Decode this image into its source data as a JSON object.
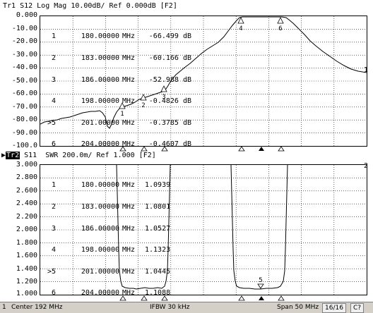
{
  "trace1": {
    "header": "Tr1 S12 Log Mag 10.00dB/ Ref 0.000dB [F2]",
    "y_labels": [
      "0.000",
      "-10.00",
      "-20.00",
      "-30.00",
      "-40.00",
      "-50.00",
      "-60.00",
      "-70.00",
      "-80.00",
      "-90.00",
      "-100.0"
    ],
    "right_tag": "1",
    "markers": [
      {
        "id": "1",
        "freq": "180.00000",
        "unit": "MHz",
        "value": "-66.499 dB"
      },
      {
        "id": "2",
        "freq": "183.00000",
        "unit": "MHz",
        "value": "-60.166 dB"
      },
      {
        "id": "3",
        "freq": "186.00000",
        "unit": "MHz",
        "value": "-52.988 dB"
      },
      {
        "id": "4",
        "freq": "198.00000",
        "unit": "MHz",
        "value": "-0.4826 dB"
      },
      {
        "id": ">5",
        "freq": "201.00000",
        "unit": "MHz",
        "value": "-0.3785 dB"
      },
      {
        "id": "6",
        "freq": "204.00000",
        "unit": "MHz",
        "value": "-0.4607 dB"
      }
    ],
    "marker_tags": [
      "1",
      "2",
      "3",
      "4",
      "5",
      "6"
    ]
  },
  "trace2": {
    "tag": "Tr2",
    "header_rest": " S11  SWR 200.0m/ Ref 1.000 [F2]",
    "y_labels": [
      "3.000",
      "2.800",
      "2.600",
      "2.400",
      "2.200",
      "2.000",
      "1.800",
      "1.600",
      "1.400",
      "1.200",
      "1.000"
    ],
    "right_tag": "2",
    "markers": [
      {
        "id": "1",
        "freq": "180.00000",
        "unit": "MHz",
        "value": "1.0939"
      },
      {
        "id": "2",
        "freq": "183.00000",
        "unit": "MHz",
        "value": "1.0801"
      },
      {
        "id": "3",
        "freq": "186.00000",
        "unit": "MHz",
        "value": "1.0527"
      },
      {
        "id": "4",
        "freq": "198.00000",
        "unit": "MHz",
        "value": "1.1323"
      },
      {
        "id": ">5",
        "freq": "201.00000",
        "unit": "MHz",
        "value": "1.0445"
      },
      {
        "id": "6",
        "freq": "204.00000",
        "unit": "MHz",
        "value": "1.1088"
      }
    ],
    "marker_tags": [
      "5"
    ]
  },
  "status": {
    "channel": "1",
    "center": "Center 192 MHz",
    "ifbw": "IFBW 30 kHz",
    "span": "Span 50 MHz",
    "points": "16/16",
    "cal": "C?"
  },
  "colors": {
    "trace": "#000000",
    "grid": "#000000",
    "background": "#ffffff",
    "statusbar": "#d4d0c8"
  }
}
